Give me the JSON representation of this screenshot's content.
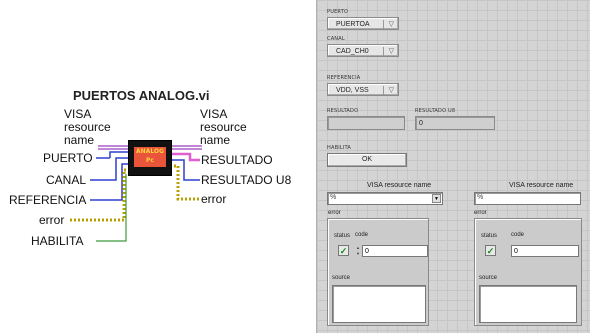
{
  "vi": {
    "title": "PUERTOS ANALOG.vi",
    "icon_text": "ANALOG Pc",
    "inputs": {
      "visa_line1": "VISA",
      "visa_line2": "resource",
      "visa_line3": "name",
      "puerto": "PUERTO",
      "canal": "CANAL",
      "referencia": "REFERENCIA",
      "error": "error",
      "habilita": "HABILITA"
    },
    "outputs": {
      "visa_line1": "VISA",
      "visa_line2": "resource",
      "visa_line3": "name",
      "resultado": "RESULTADO",
      "resultado_u8": "RESULTADO U8",
      "error": "error"
    },
    "colors": {
      "visa_wire": "#9a3fbf",
      "enum_wire": "#2d3fd1",
      "numeric_wire": "#e05fd0",
      "error_wire": "#b8a000",
      "bool_wire": "#3c9a3c"
    }
  },
  "panel": {
    "puerto": {
      "label": "PUERTO",
      "value": "PUERTOA"
    },
    "canal": {
      "label": "CANAL",
      "value": "CAD_CH0"
    },
    "referencia": {
      "label": "REFERENCIA",
      "value": "VDD, VSS"
    },
    "resultado": {
      "label": "RESULTADO",
      "value": ""
    },
    "resultado_u8": {
      "label": "RESULTADO U8",
      "value": "0"
    },
    "habilita": {
      "label": "HABILITA",
      "button": "OK"
    },
    "visa_in": {
      "label": "VISA resource name",
      "icon": "%"
    },
    "visa_out": {
      "label": "VISA resource name",
      "icon": "%"
    },
    "error_in": {
      "label": "error",
      "status_label": "status",
      "code_label": "code",
      "code_value": "0",
      "source_label": "source"
    },
    "error_out": {
      "label": "error",
      "status_label": "status",
      "code_label": "code",
      "code_value": "0",
      "source_label": "source"
    }
  }
}
